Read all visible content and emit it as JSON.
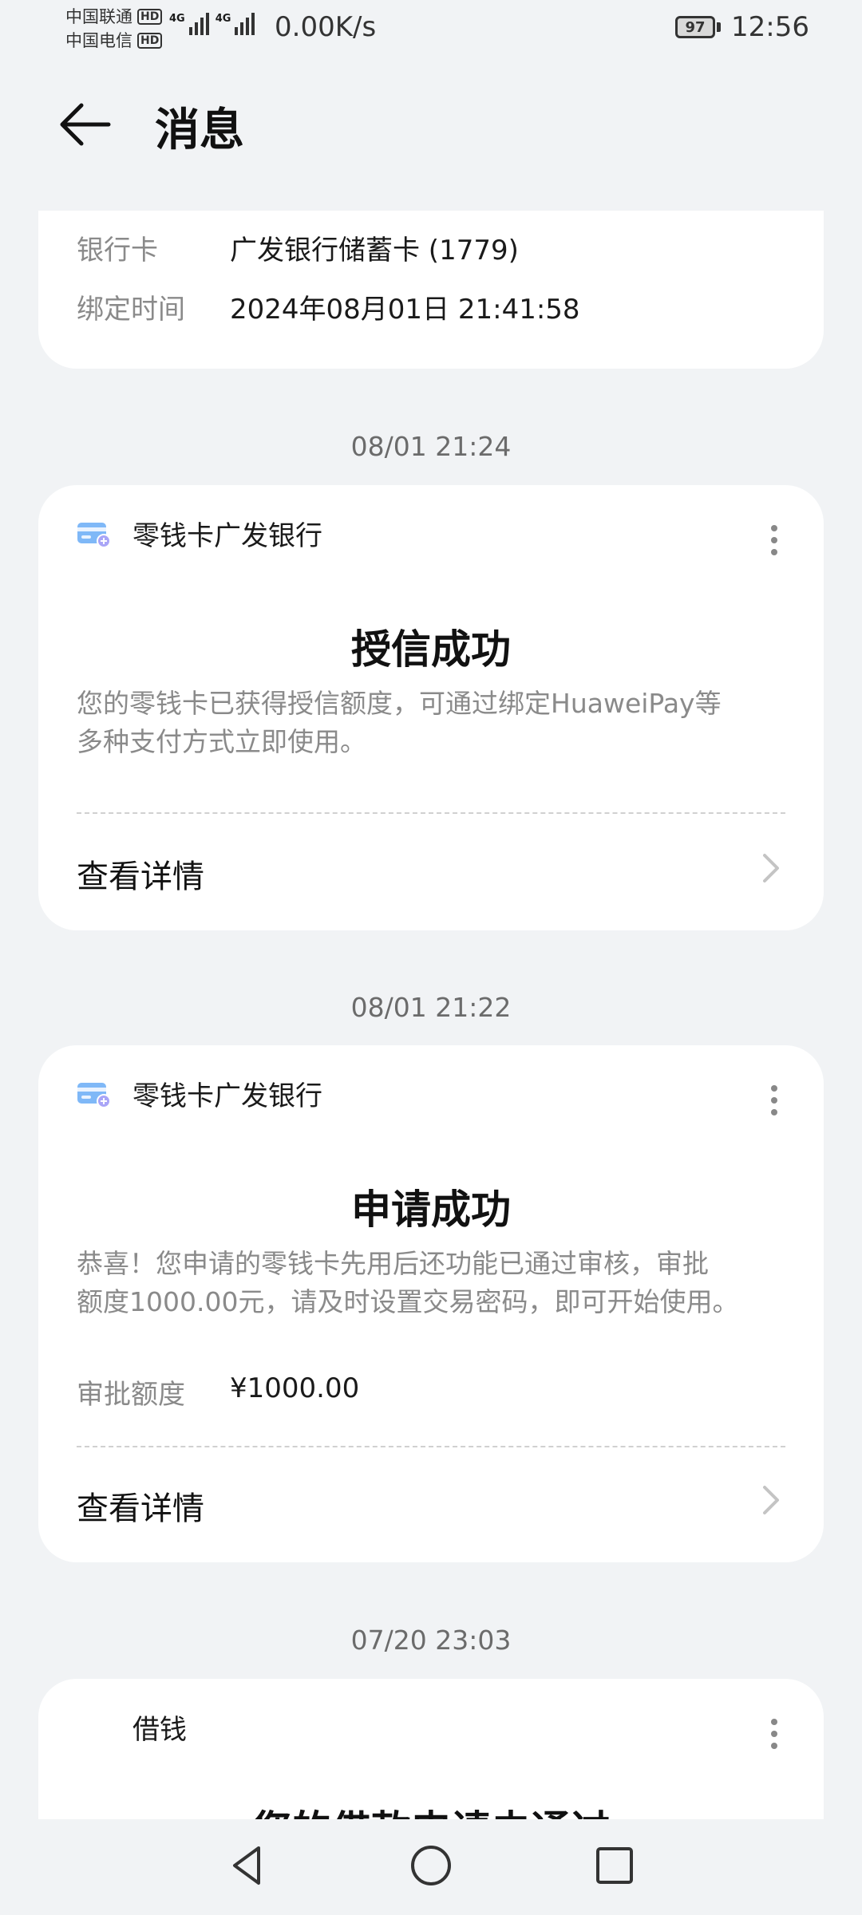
{
  "status_bar": {
    "carrier1": "中国联通",
    "carrier2": "中国电信",
    "hd": "HD",
    "net_type": "4G",
    "net_speed": "0.00K/s",
    "battery": "97",
    "time": "12:56"
  },
  "header": {
    "title": "消息"
  },
  "top_card": {
    "bank_label": "银行卡",
    "bank_value": "广发银行储蓄卡 (1779)",
    "bind_label": "绑定时间",
    "bind_value": "2024年08月01日 21:41:58"
  },
  "messages": [
    {
      "timestamp": "08/01 21:24",
      "source": "零钱卡广发银行",
      "title": "授信成功",
      "desc_line1": "您的零钱卡已获得授信额度，可通过绑定HuaweiPay等",
      "desc_line2": "多种支付方式立即使用。",
      "action": "查看详情"
    },
    {
      "timestamp": "08/01 21:22",
      "source": "零钱卡广发银行",
      "title": "申请成功",
      "desc_line1": "恭喜！您申请的零钱卡先用后还功能已通过审核，审批",
      "desc_line2": "额度1000.00元，请及时设置交易密码，即可开始使用。",
      "amount_label": "审批额度",
      "amount_value": "¥1000.00",
      "action": "查看详情"
    },
    {
      "timestamp": "07/20 23:03",
      "source": "借钱",
      "title": "您的借款申请未通过"
    }
  ],
  "colors": {
    "background": "#f1f3f5",
    "card": "#ffffff",
    "accent_icon": "#3f8cf5"
  }
}
